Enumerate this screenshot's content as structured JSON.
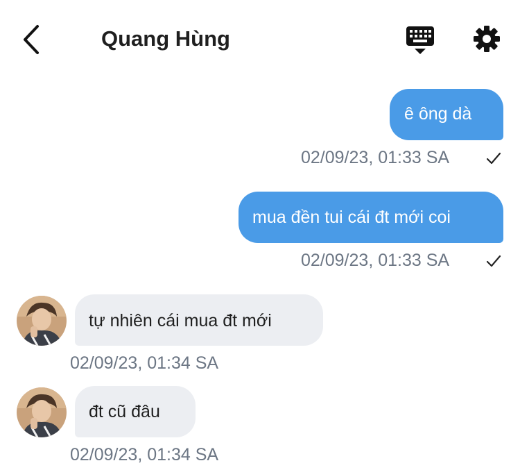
{
  "header": {
    "title": "Quang Hùng",
    "back_icon": "chevron-left-icon",
    "keyboard_icon": "keyboard-icon",
    "settings_icon": "gear-icon"
  },
  "colors": {
    "outgoing_bubble": "#4a9be7",
    "incoming_bubble": "#eceef2",
    "timestamp": "#6c7684"
  },
  "messages": [
    {
      "direction": "outgoing",
      "text": "ê ông dà",
      "time": "02/09/23, 01:33 SA",
      "status": "sent-check-icon"
    },
    {
      "direction": "outgoing",
      "text": "mua đền tui cái đt mới coi",
      "time": "02/09/23, 01:33 SA",
      "status": "sent-check-icon"
    },
    {
      "direction": "incoming",
      "text": "tự nhiên cái mua đt mới",
      "time": "02/09/23, 01:34 SA"
    },
    {
      "direction": "incoming",
      "text": "đt cũ đâu",
      "time": "02/09/23, 01:34 SA"
    }
  ]
}
